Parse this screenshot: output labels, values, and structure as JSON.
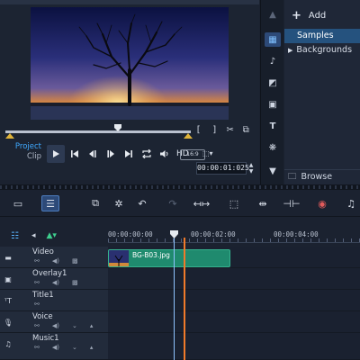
{
  "player": {
    "modes": {
      "project": "Project",
      "clip": "Clip"
    },
    "hd_label": "HD",
    "aspect_label": "16:9",
    "timecode": "00:00:01:025"
  },
  "library": {
    "add_label": "Add",
    "items": [
      {
        "label": "Samples",
        "selected": true
      },
      {
        "label": "Backgrounds",
        "selected": false
      }
    ],
    "browse_label": "Browse"
  },
  "timeline": {
    "ruler_ticks": [
      "00:00:00:00",
      "00:00:02:00",
      "00:00:04:00"
    ],
    "tracks": [
      {
        "name": "Video",
        "icon": "film-icon"
      },
      {
        "name": "Overlay1",
        "icon": "overlay-icon"
      },
      {
        "name": "Title1",
        "icon": "title-icon"
      },
      {
        "name": "Voice",
        "icon": "microphone-icon"
      },
      {
        "name": "Music1",
        "icon": "music-note-icon"
      }
    ],
    "clip_label": "BG-B03.jpg"
  },
  "colors": {
    "accent": "#3fa9ff",
    "selection": "#25527e",
    "clip": "#1f8a6e",
    "playhead": "#f07a2a",
    "scrub_marker": "#e0b43a"
  }
}
